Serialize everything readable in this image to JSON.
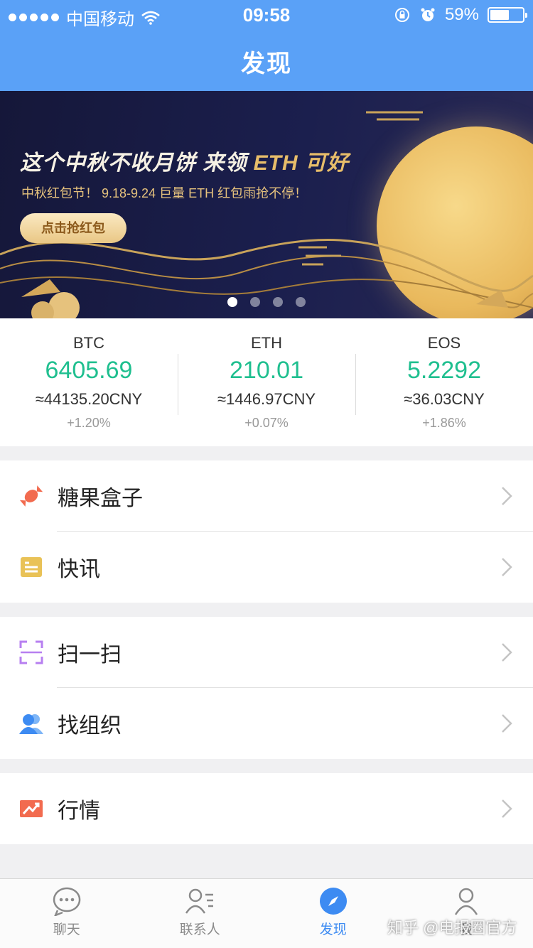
{
  "status": {
    "carrier": "中国移动",
    "time": "09:58",
    "battery": "59%",
    "battery_level": 0.59
  },
  "header": {
    "title": "发现"
  },
  "banner": {
    "title_a": "这个中秋不收月饼 来领 ",
    "title_b": "ETH 可好",
    "subtitle": "中秋红包节！ 9.18-9.24 巨量 ETH 红包雨抢不停！",
    "button": "点击抢红包",
    "pages": 4,
    "active_page": 0
  },
  "tickers": [
    {
      "symbol": "BTC",
      "price": "6405.69",
      "cny": "≈44135.20CNY",
      "change": "+1.20%"
    },
    {
      "symbol": "ETH",
      "price": "210.01",
      "cny": "≈1446.97CNY",
      "change": "+0.07%"
    },
    {
      "symbol": "EOS",
      "price": "5.2292",
      "cny": "≈36.03CNY",
      "change": "+1.86%"
    }
  ],
  "menu": {
    "candy": "糖果盒子",
    "news": "快讯",
    "scan": "扫一扫",
    "org": "找组织",
    "market": "行情"
  },
  "tabs": {
    "chat": "聊天",
    "contacts": "联系人",
    "discover": "发现",
    "me": "我"
  },
  "watermark": "知乎 @电报圈官方",
  "colors": {
    "accent": "#5aa1f7",
    "price_green": "#1fbf8f",
    "tab_active": "#3d8bf2"
  }
}
